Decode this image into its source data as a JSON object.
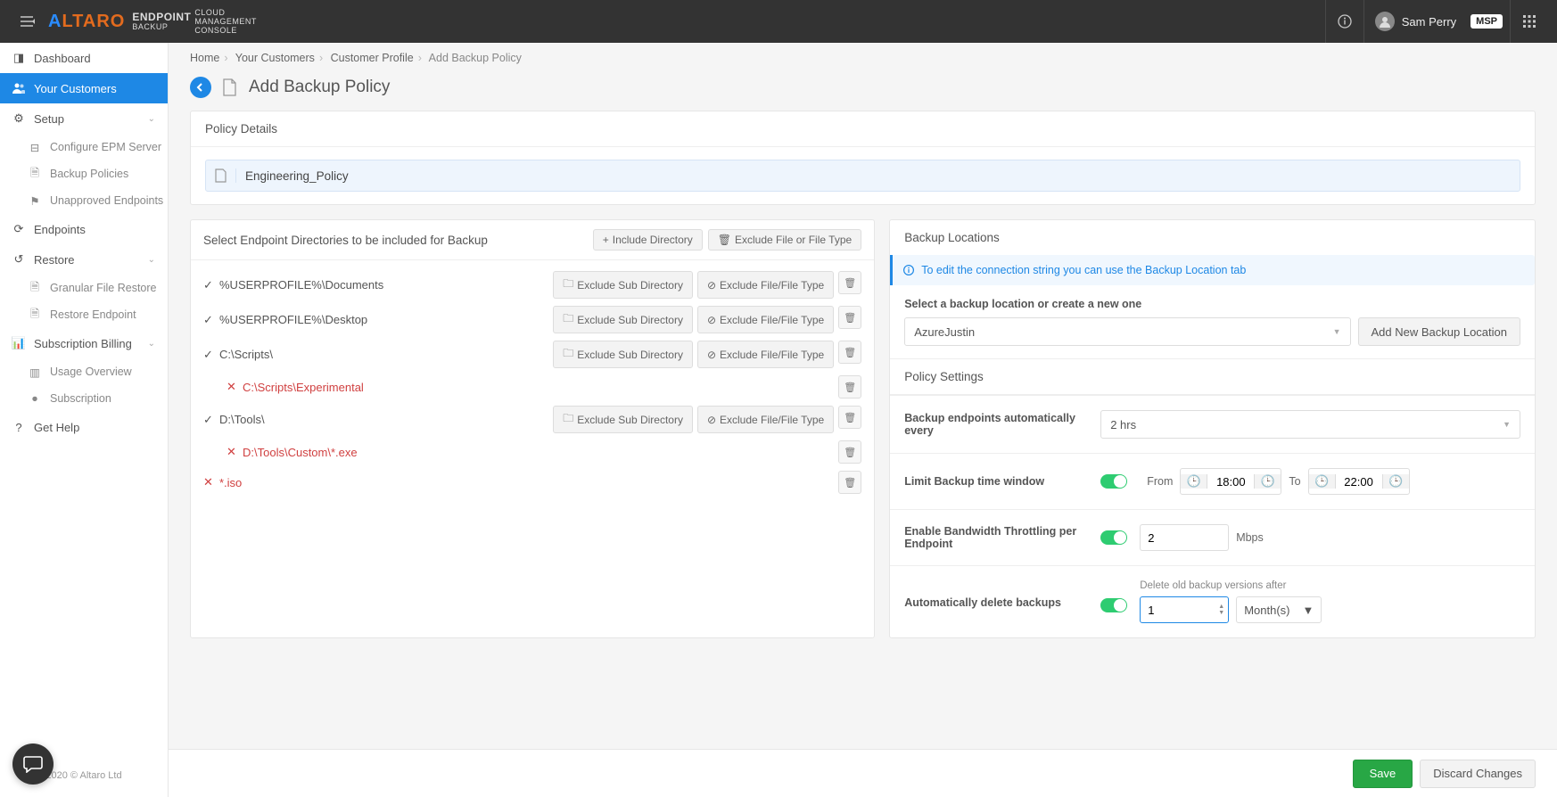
{
  "topbar": {
    "logo_brand_a": "A",
    "logo_brand_rest": "LTARO",
    "logo_sub_line1": "ENDPOINT",
    "logo_sub_line2": "BACKUP",
    "logo_sub_line3": "CLOUD",
    "logo_sub_line4": "MANAGEMENT",
    "logo_sub_line5": "CONSOLE",
    "user_name": "Sam Perry",
    "msp_badge": "MSP"
  },
  "sidebar": {
    "items": [
      {
        "icon": "dashboard",
        "label": "Dashboard"
      },
      {
        "icon": "users",
        "label": "Your Customers"
      },
      {
        "icon": "gear",
        "label": "Setup",
        "expandable": true
      },
      {
        "icon": "sync",
        "label": "Endpoints"
      },
      {
        "icon": "restore",
        "label": "Restore",
        "expandable": true
      },
      {
        "icon": "chart",
        "label": "Subscription Billing",
        "expandable": true
      },
      {
        "icon": "help",
        "label": "Get Help"
      }
    ],
    "setup_sub": [
      {
        "icon": "server",
        "label": "Configure EPM Server"
      },
      {
        "icon": "doc",
        "label": "Backup Policies"
      },
      {
        "icon": "flag",
        "label": "Unapproved Endpoints"
      }
    ],
    "restore_sub": [
      {
        "icon": "doc",
        "label": "Granular File Restore"
      },
      {
        "icon": "doc",
        "label": "Restore Endpoint"
      }
    ],
    "billing_sub": [
      {
        "icon": "bars",
        "label": "Usage Overview"
      },
      {
        "icon": "dot",
        "label": "Subscription"
      }
    ],
    "footer": "2020  © Altaro Ltd"
  },
  "breadcrumb": {
    "items": [
      "Home",
      "Your Customers",
      "Customer Profile",
      "Add Backup Policy"
    ]
  },
  "page_title": "Add Backup Policy",
  "policy_details": {
    "header": "Policy Details",
    "name_value": "Engineering_Policy"
  },
  "directories": {
    "header": "Select Endpoint Directories to be included for Backup",
    "include_btn": "Include Directory",
    "exclude_btn": "Exclude File or File Type",
    "excl_sub_btn": "Exclude Sub Directory",
    "excl_file_btn": "Exclude File/File Type",
    "rows": [
      {
        "type": "include",
        "path": "%USERPROFILE%\\Documents",
        "has_actions": true
      },
      {
        "type": "include",
        "path": "%USERPROFILE%\\Desktop",
        "has_actions": true
      },
      {
        "type": "include",
        "path": "C:\\Scripts\\",
        "has_actions": true
      },
      {
        "type": "exclude",
        "path": "C:\\Scripts\\Experimental",
        "indent": true,
        "delete_only": true
      },
      {
        "type": "include",
        "path": "D:\\Tools\\",
        "has_actions": true
      },
      {
        "type": "exclude",
        "path": "D:\\Tools\\Custom\\*.exe",
        "indent": true,
        "delete_only": true
      },
      {
        "type": "exclude",
        "path": "*.iso",
        "delete_only": true
      }
    ]
  },
  "locations": {
    "header": "Backup Locations",
    "info": "To edit the connection string you can use the Backup Location tab",
    "select_label": "Select a backup location or create a new one",
    "selected": "AzureJustin",
    "add_btn": "Add New Backup Location"
  },
  "settings": {
    "header": "Policy Settings",
    "freq_label": "Backup endpoints automatically every",
    "freq_value": "2 hrs",
    "window_label": "Limit Backup time window",
    "from_label": "From",
    "from_value": "18:00",
    "to_label": "To",
    "to_value": "22:00",
    "throttle_label": "Enable Bandwidth Throttling per Endpoint",
    "throttle_value": "2",
    "throttle_unit": "Mbps",
    "auto_delete_label": "Automatically delete backups",
    "delete_hint": "Delete old backup versions after",
    "delete_value": "1",
    "delete_unit": "Month(s)"
  },
  "footer": {
    "save": "Save",
    "discard": "Discard Changes"
  }
}
